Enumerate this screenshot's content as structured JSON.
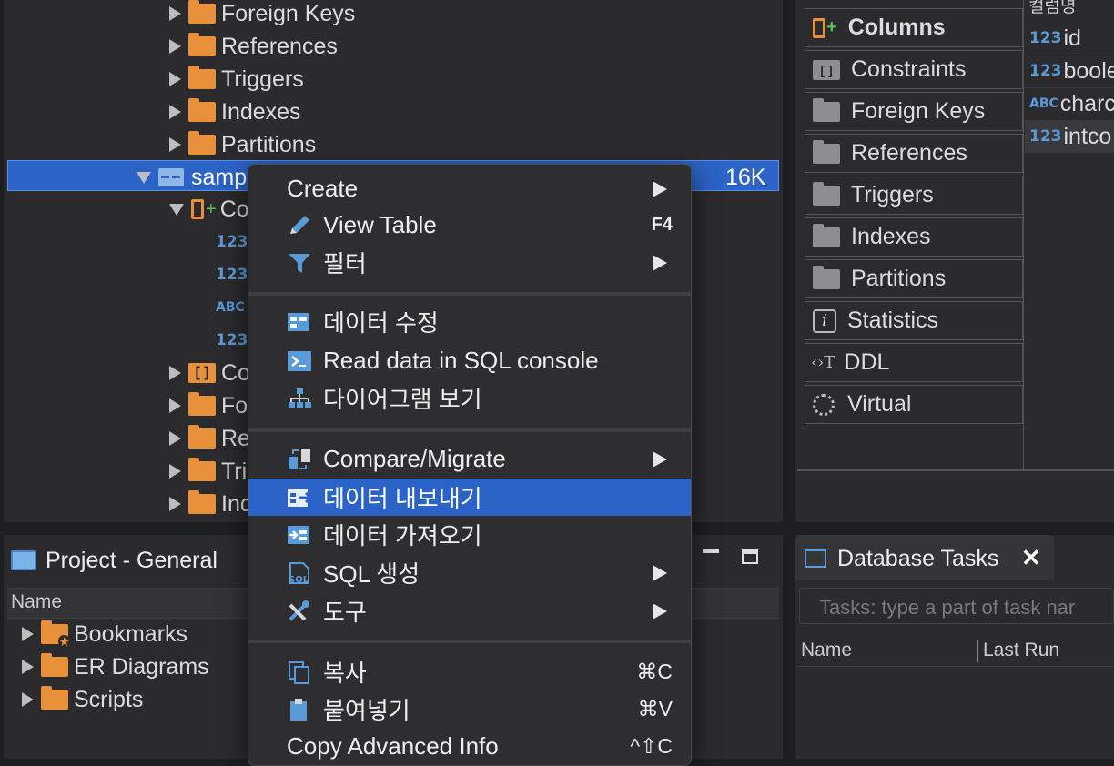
{
  "tree": {
    "top_items": [
      "Foreign Keys",
      "References",
      "Triggers",
      "Indexes",
      "Partitions"
    ],
    "selected_table": "samp",
    "selected_size": "16K",
    "columns_label": "Co",
    "column_types": [
      "123",
      "123",
      "ABC",
      "123"
    ],
    "sub_items": [
      "Co",
      "Fo",
      "Re",
      "Tri",
      "Ind"
    ]
  },
  "right_panel": {
    "tabs": [
      "Columns",
      "Constraints",
      "Foreign Keys",
      "References",
      "Triggers",
      "Indexes",
      "Partitions",
      "Statistics",
      "DDL",
      "Virtual"
    ],
    "column_header": "컬럼명",
    "columns": [
      {
        "type": "123",
        "name": "id"
      },
      {
        "type": "123",
        "name": "boole"
      },
      {
        "type": "ABC",
        "name": "charc"
      },
      {
        "type": "123",
        "name": "intco"
      }
    ]
  },
  "project": {
    "title": "Project - General",
    "name_header": "Name",
    "items": [
      "Bookmarks",
      "ER Diagrams",
      "Scripts"
    ]
  },
  "tasks": {
    "title": "Database Tasks",
    "filter_placeholder": "Tasks: type a part of task nar",
    "col_name": "Name",
    "col_last_run": "Last Run"
  },
  "context_menu": {
    "items": [
      {
        "label": "Create",
        "shortcut": "",
        "submenu": true
      },
      {
        "label": "View Table",
        "shortcut": "F4",
        "submenu": false
      },
      {
        "label": "필터",
        "shortcut": "",
        "submenu": true
      },
      {
        "label": "데이터 수정",
        "shortcut": "",
        "submenu": false
      },
      {
        "label": "Read data in SQL console",
        "shortcut": "",
        "submenu": false
      },
      {
        "label": "다이어그램 보기",
        "shortcut": "",
        "submenu": false
      },
      {
        "label": "Compare/Migrate",
        "shortcut": "",
        "submenu": true
      },
      {
        "label": "데이터 내보내기",
        "shortcut": "",
        "submenu": false
      },
      {
        "label": "데이터 가져오기",
        "shortcut": "",
        "submenu": false
      },
      {
        "label": "SQL 생성",
        "shortcut": "",
        "submenu": true
      },
      {
        "label": "도구",
        "shortcut": "",
        "submenu": true
      },
      {
        "label": "복사",
        "shortcut": "⌘C",
        "submenu": false
      },
      {
        "label": "붙여넣기",
        "shortcut": "⌘V",
        "submenu": false
      },
      {
        "label": "Copy Advanced Info",
        "shortcut": "^⇧C",
        "submenu": false
      }
    ]
  },
  "colors": {
    "selection": "#2b63c6",
    "folder": "#e8903a",
    "type_blue": "#5b9ad8"
  }
}
